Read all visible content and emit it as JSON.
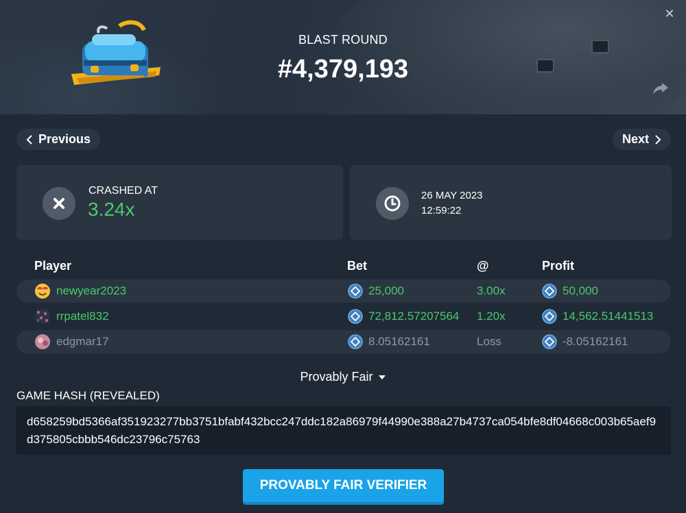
{
  "header": {
    "subtitle": "BLAST ROUND",
    "round_number": "#4,379,193"
  },
  "nav": {
    "previous_label": "Previous",
    "next_label": "Next"
  },
  "crash": {
    "label": "CRASHED AT",
    "value": "3.24x",
    "icon": "close-icon"
  },
  "time": {
    "date": "26 MAY 2023",
    "time": "12:59:22",
    "icon": "clock-icon"
  },
  "table": {
    "headers": {
      "player": "Player",
      "bet": "Bet",
      "at": "@",
      "profit": "Profit"
    },
    "rows": [
      {
        "player": "newyear2023",
        "bet": "25,000",
        "at": "3.00x",
        "profit": "50,000",
        "status": "win"
      },
      {
        "player": "rrpatel832",
        "bet": "72,812.57207564",
        "at": "1.20x",
        "profit": "14,562.51441513",
        "status": "win"
      },
      {
        "player": "edgmar17",
        "bet": "8.05162161",
        "at": "Loss",
        "profit": "-8.05162161",
        "status": "loss"
      }
    ]
  },
  "fair": {
    "toggle_label": "Provably Fair",
    "hash_label": "GAME HASH (REVEALED)",
    "hash_value": "d658259bd5366af351923277bb3751bfabf432bcc247ddc182a86979f44990e388a27b4737ca054bfe8df04668c003b65aef9d375805cbbb546dc23796c75763",
    "verify_label": "PROVABLY FAIR VERIFIER"
  },
  "colors": {
    "win": "#4cc96b",
    "loss": "#8d98a4",
    "accent": "#1aa3e8"
  }
}
